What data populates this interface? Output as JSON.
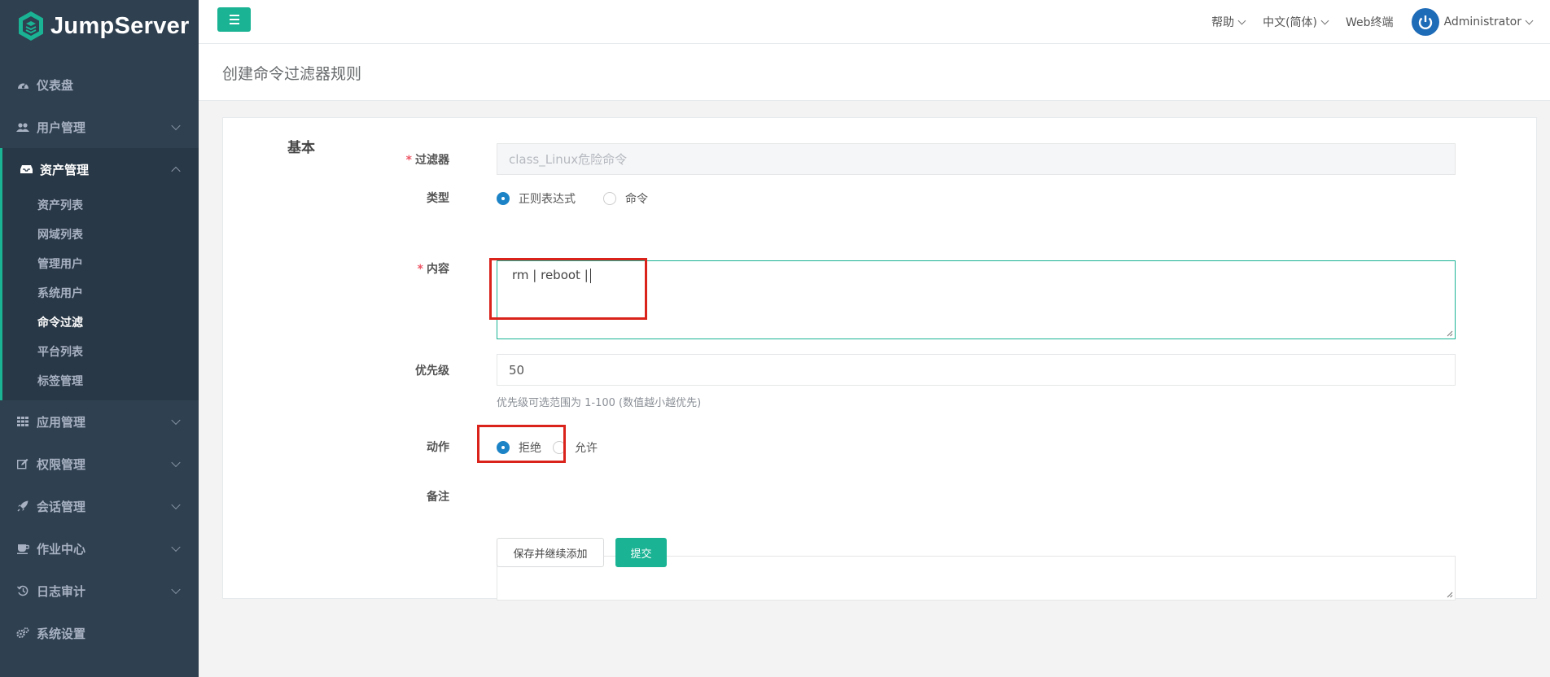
{
  "app": {
    "name": "JumpServer"
  },
  "sidebar": {
    "items": [
      {
        "label": "仪表盘",
        "icon": "dashboard-icon"
      },
      {
        "label": "用户管理",
        "icon": "users-icon"
      },
      {
        "label": "资产管理",
        "icon": "inbox-icon",
        "expanded": true,
        "children": [
          "资产列表",
          "网域列表",
          "管理用户",
          "系统用户",
          "命令过滤",
          "平台列表",
          "标签管理"
        ],
        "active_child": "命令过滤"
      },
      {
        "label": "应用管理",
        "icon": "grid-icon"
      },
      {
        "label": "权限管理",
        "icon": "edit-icon"
      },
      {
        "label": "会话管理",
        "icon": "rocket-icon"
      },
      {
        "label": "作业中心",
        "icon": "coffee-icon"
      },
      {
        "label": "日志审计",
        "icon": "history-icon"
      },
      {
        "label": "系统设置",
        "icon": "cogs-icon"
      }
    ]
  },
  "topbar": {
    "help": "帮助",
    "language": "中文(简体)",
    "web_terminal": "Web终端",
    "user": "Administrator"
  },
  "page": {
    "title": "创建命令过滤器规则"
  },
  "form": {
    "section": "基本",
    "filter": {
      "label": "过滤器",
      "value": "class_Linux危险命令",
      "required": true
    },
    "type": {
      "label": "类型",
      "options": [
        "正则表达式",
        "命令"
      ],
      "selected": "正则表达式"
    },
    "content": {
      "label": "内容",
      "value": "rm | reboot |",
      "required": true
    },
    "priority": {
      "label": "优先级",
      "value": "50",
      "help": "优先级可选范围为 1-100 (数值越小越优先)"
    },
    "action": {
      "label": "动作",
      "options": [
        "拒绝",
        "允许"
      ],
      "selected": "拒绝"
    },
    "comment": {
      "label": "备注",
      "value": ""
    },
    "buttons": {
      "save_continue": "保存并继续添加",
      "submit": "提交"
    }
  },
  "colors": {
    "sidebar": "#2f4050",
    "accent": "#1ab394",
    "radio": "#1c84c6",
    "highlight": "#d9231b"
  }
}
